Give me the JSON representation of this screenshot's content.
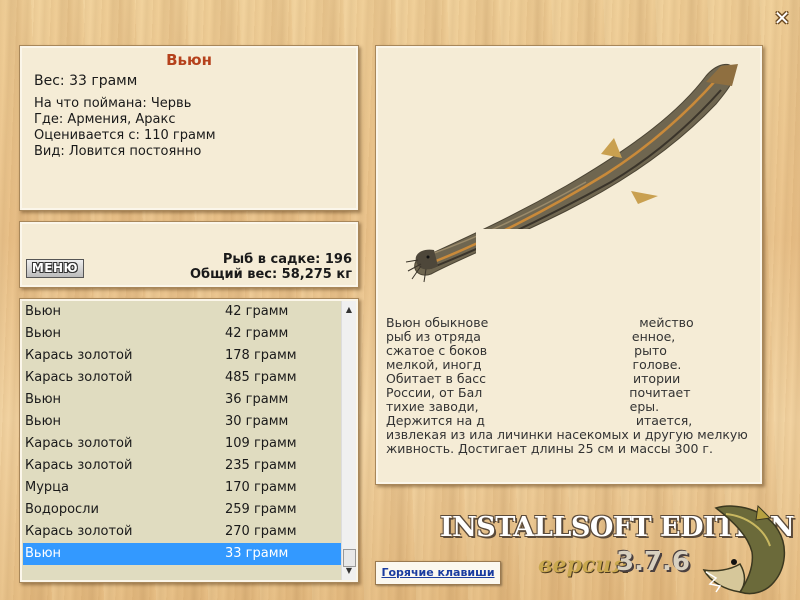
{
  "close_label": "✕",
  "info": {
    "title": "Вьюн",
    "weight": "Вес: 33 грамм",
    "lines": [
      "На что поймана: Червь",
      "Где: Армения, Аракс",
      "Оценивается с: 110 грамм",
      "Вид: Ловится постоянно"
    ]
  },
  "stats": {
    "menu_label": "МЕНЮ",
    "fish_in_net": "Рыб в садке: 196",
    "total_weight": "Общий вес: 58,275 кг"
  },
  "catch_list": [
    {
      "name": "Вьюн",
      "weight": "42 грамм"
    },
    {
      "name": "Вьюн",
      "weight": "42 грамм"
    },
    {
      "name": "Карась золотой",
      "weight": "178 грамм"
    },
    {
      "name": "Карась золотой",
      "weight": "485 грамм"
    },
    {
      "name": "Вьюн",
      "weight": "36 грамм"
    },
    {
      "name": "Вьюн",
      "weight": "30 грамм"
    },
    {
      "name": "Карась золотой",
      "weight": "109 грамм"
    },
    {
      "name": "Карась золотой",
      "weight": "235 грамм"
    },
    {
      "name": "Мурца",
      "weight": "170 грамм"
    },
    {
      "name": "Водоросли",
      "weight": "259 грамм"
    },
    {
      "name": "Карась золотой",
      "weight": "270 грамм"
    },
    {
      "name": "Вьюн",
      "weight": "33 грамм",
      "selected": true
    }
  ],
  "description_lines": [
    "Вьюн обыкнове                                      мейство",
    "рыб из отряда                                      енное,",
    "сжатое с боков                                     рыто",
    "мелкой, иногд                                      голове.",
    "Обитает в басс                                     итории",
    "России, от Бал                                     почитает",
    "тихие заводи,                                      еры.",
    "Держится на д                                      итается,",
    "извлекая из ила личинки насекомых и другую мелкую",
    "живность. Достигает длины 25 см и массы 300 г."
  ],
  "branding": {
    "edition": "INSTALLSOFT EDITION",
    "version_label": "версия",
    "version_number": "3.7.6"
  },
  "hotkeys_label": "Горячие клавиши",
  "colors": {
    "title": "#b5411c",
    "selection": "#3399ff",
    "link": "#1a3ca0"
  }
}
